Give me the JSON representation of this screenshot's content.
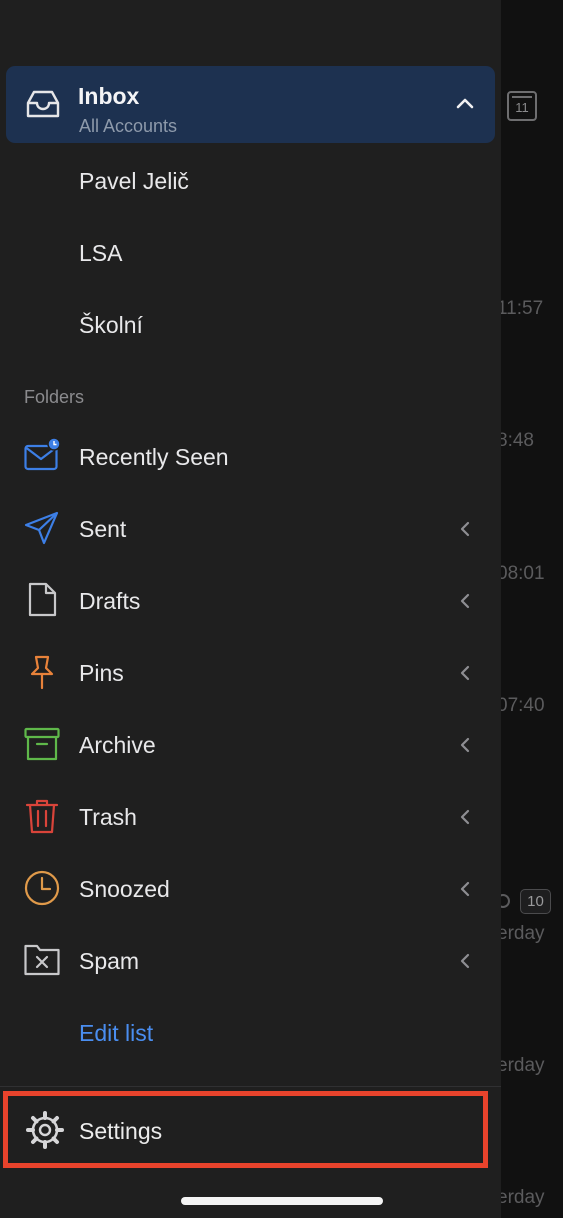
{
  "background_list": {
    "calendar_badge": "11",
    "times": [
      "11:57",
      "8:48",
      "08:01",
      "07:40",
      "erday",
      "erday",
      "erday"
    ],
    "thread_count": "10"
  },
  "drawer": {
    "inbox": {
      "title": "Inbox",
      "subtitle": "All Accounts",
      "icon": "inbox-tray-icon",
      "expanded": true
    },
    "accounts": [
      {
        "label": "Pavel Jelič"
      },
      {
        "label": "LSA"
      },
      {
        "label": "Školní"
      }
    ],
    "folders_header": "Folders",
    "folders": [
      {
        "label": "Recently Seen",
        "icon": "recently-seen-icon",
        "color": "#3d7fe6",
        "expandable": false
      },
      {
        "label": "Sent",
        "icon": "paper-plane-icon",
        "color": "#3d7fe6",
        "expandable": true
      },
      {
        "label": "Drafts",
        "icon": "document-icon",
        "color": "#c8c8ca",
        "expandable": true
      },
      {
        "label": "Pins",
        "icon": "pushpin-icon",
        "color": "#e8823a",
        "expandable": true
      },
      {
        "label": "Archive",
        "icon": "archive-box-icon",
        "color": "#5fb84a",
        "expandable": true
      },
      {
        "label": "Trash",
        "icon": "trash-icon",
        "color": "#d9443a",
        "expandable": true
      },
      {
        "label": "Snoozed",
        "icon": "clock-icon",
        "color": "#e09a4a",
        "expandable": true
      },
      {
        "label": "Spam",
        "icon": "spam-folder-icon",
        "color": "#c8c8ca",
        "expandable": true
      }
    ],
    "edit_list": "Edit list",
    "settings": {
      "label": "Settings",
      "icon": "gear-icon"
    }
  },
  "colors": {
    "accent": "#4a8ef0",
    "selected_row": "#1d3150",
    "drawer_bg": "#1f1f1f",
    "highlight_box": "#e8432c"
  }
}
